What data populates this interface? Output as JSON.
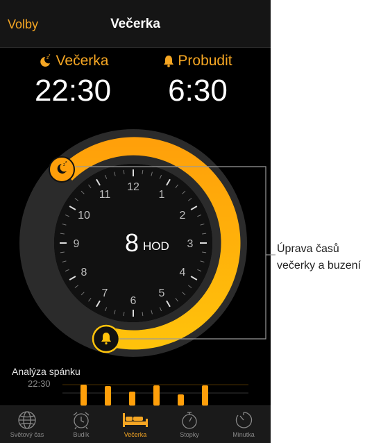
{
  "navbar": {
    "left_label": "Volby",
    "title": "Večerka"
  },
  "bedtime": {
    "label": "Večerka",
    "time": "22:30"
  },
  "wake": {
    "label": "Probudit",
    "time": "6:30"
  },
  "dial": {
    "duration_value": "8",
    "duration_unit": "HOD",
    "hour_labels": [
      "12",
      "1",
      "2",
      "3",
      "4",
      "5",
      "6",
      "7",
      "8",
      "9",
      "10",
      "11"
    ],
    "bed_icon": "moon-zzz-icon",
    "wake_icon": "bell-icon",
    "accent_color": "#ffb300"
  },
  "sleep_analysis": {
    "title": "Analýza spánku",
    "time_label": "22:30",
    "bar_count": 6
  },
  "tabs": [
    {
      "label": "Světový čas",
      "icon": "globe-icon",
      "active": false
    },
    {
      "label": "Budík",
      "icon": "alarm-clock-icon",
      "active": false
    },
    {
      "label": "Večerka",
      "icon": "bed-icon",
      "active": true
    },
    {
      "label": "Stopky",
      "icon": "stopwatch-icon",
      "active": false
    },
    {
      "label": "Minutka",
      "icon": "timer-icon",
      "active": false
    }
  ],
  "callout": {
    "line1": "Úprava časů",
    "line2": "večerky a buzení"
  }
}
